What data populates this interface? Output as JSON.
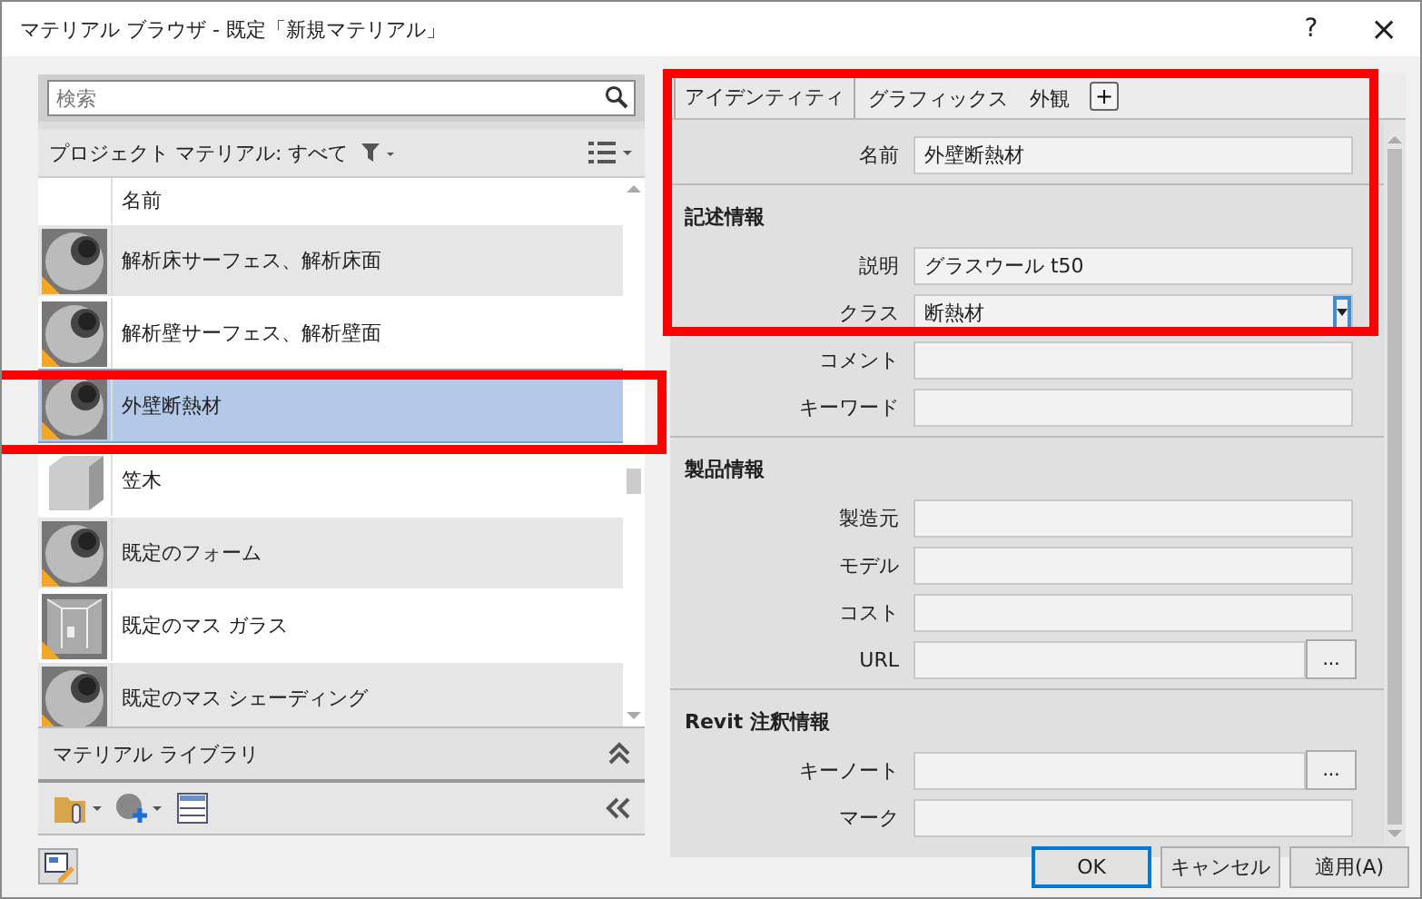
{
  "window": {
    "title": "マテリアル ブラウザ - 既定「新規マテリアル」",
    "help": "?",
    "close": "×"
  },
  "browser": {
    "search": {
      "placeholder": "検索"
    },
    "filter_label": "プロジェクト マテリアル: すべて",
    "column": "名前",
    "materials": [
      {
        "name": "解析床サーフェス、解析床面",
        "kind": "sphere",
        "warning": true,
        "selected": false
      },
      {
        "name": "解析壁サーフェス、解析壁面",
        "kind": "sphere",
        "warning": true,
        "selected": false
      },
      {
        "name": "外壁断熱材",
        "kind": "sphere",
        "warning": true,
        "selected": true
      },
      {
        "name": "笠木",
        "kind": "cube",
        "warning": false,
        "selected": false
      },
      {
        "name": "既定のフォーム",
        "kind": "sphere",
        "warning": true,
        "selected": false
      },
      {
        "name": "既定のマス ガラス",
        "kind": "glass",
        "warning": true,
        "selected": false
      },
      {
        "name": "既定のマス シェーディング",
        "kind": "sphere",
        "warning": true,
        "selected": false
      }
    ],
    "library_label": "マテリアル ライブラリ"
  },
  "tabs": [
    {
      "label": "アイデンティティ",
      "selected": true
    },
    {
      "label": "グラフィックス",
      "selected": false
    },
    {
      "label": "外観",
      "selected": false
    }
  ],
  "tab_add": "+",
  "sections": [
    {
      "fields": [
        {
          "label": "名前",
          "kind": "text",
          "value": "外壁断熱材"
        }
      ]
    },
    {
      "title": "記述情報",
      "fields": [
        {
          "label": "説明",
          "kind": "text",
          "value": "グラスウール t50"
        },
        {
          "label": "クラス",
          "kind": "dropdown",
          "value": "断熱材"
        },
        {
          "label": "コメント",
          "kind": "text"
        },
        {
          "label": "キーワード",
          "kind": "text"
        }
      ]
    },
    {
      "title": "製品情報",
      "fields": [
        {
          "label": "製造元",
          "kind": "text"
        },
        {
          "label": "モデル",
          "kind": "text"
        },
        {
          "label": "コスト",
          "kind": "text"
        },
        {
          "label": "URL",
          "kind": "browse",
          "button": "..."
        }
      ]
    },
    {
      "title": "Revit 注釈情報",
      "fields": [
        {
          "label": "キーノート",
          "kind": "browse",
          "button": "..."
        },
        {
          "label": "マーク",
          "kind": "text"
        }
      ]
    }
  ],
  "buttons": [
    {
      "label": "OK",
      "default": true
    },
    {
      "label": "キャンセル",
      "default": false
    },
    {
      "label": "適用(A)",
      "default": false
    }
  ]
}
